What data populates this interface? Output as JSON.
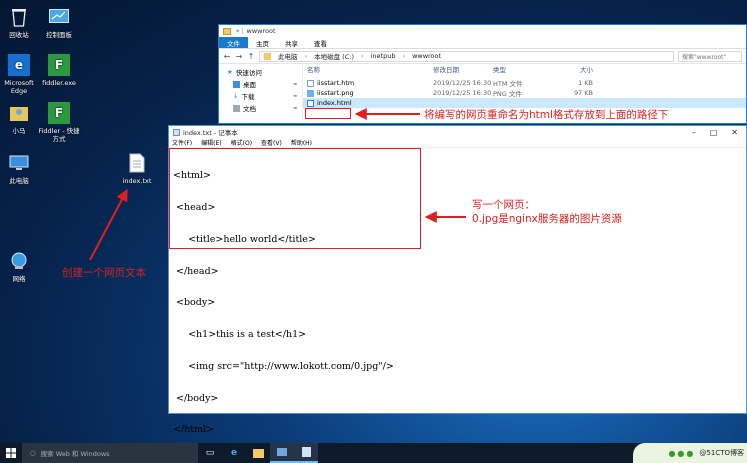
{
  "desktop": {
    "icons": [
      {
        "label": "回收站"
      },
      {
        "label": "控制面板"
      },
      {
        "label": "Microsoft Edge"
      },
      {
        "label": "fiddler.exe"
      },
      {
        "label": "小马"
      },
      {
        "label": "Fiddler - 快捷方式"
      },
      {
        "label": "此电脑"
      },
      {
        "label": "index.txt"
      },
      {
        "label": "网络"
      }
    ]
  },
  "explorer": {
    "title": "wwwroot",
    "ribbon_tabs": [
      "文件",
      "主页",
      "共享",
      "查看"
    ],
    "address": [
      "此电脑",
      "本地磁盘 (C:)",
      "inetpub",
      "wwwroot"
    ],
    "search_placeholder": "搜索\"wwwroot\"",
    "nav_items": [
      "快速访问",
      "桌面",
      "下载",
      "文档"
    ],
    "columns": [
      "名称",
      "修改日期",
      "类型",
      "大小"
    ],
    "files": [
      {
        "name": "iisstart.htm",
        "date": "2019/12/25 16:30",
        "type": "HTM 文件",
        "size": "1 KB"
      },
      {
        "name": "iisstart.png",
        "date": "2019/12/25 16:30",
        "type": "PNG 文件",
        "size": "97 KB"
      },
      {
        "name": "index.html",
        "date": "",
        "type": "",
        "size": ""
      }
    ]
  },
  "notepad": {
    "title": "index.txt - 记事本",
    "menu": [
      "文件(F)",
      "编辑(E)",
      "格式(O)",
      "查看(V)",
      "帮助(H)"
    ],
    "lines": [
      "<html>",
      " <head>",
      "     <title>hello world</title>",
      " </head>",
      " <body>",
      "     <h1>this is a test</h1>",
      "     <img src=\"http://www.lokott.com/0.jpg\"/>",
      " </body>",
      "</html>"
    ]
  },
  "annotations": {
    "rename": "将编写的网页重命名为html格式存放到上面的路径下",
    "write_line1": "写一个网页：",
    "write_line2": "0.jpg是nginx服务器的图片资源",
    "create": "创建一个网页文本"
  },
  "taskbar": {
    "search_placeholder": "搜索 Web 和 Windows",
    "watermark": "@51CTO博客"
  },
  "colors": {
    "annotation": "#e02020",
    "accent": "#1979ca"
  }
}
